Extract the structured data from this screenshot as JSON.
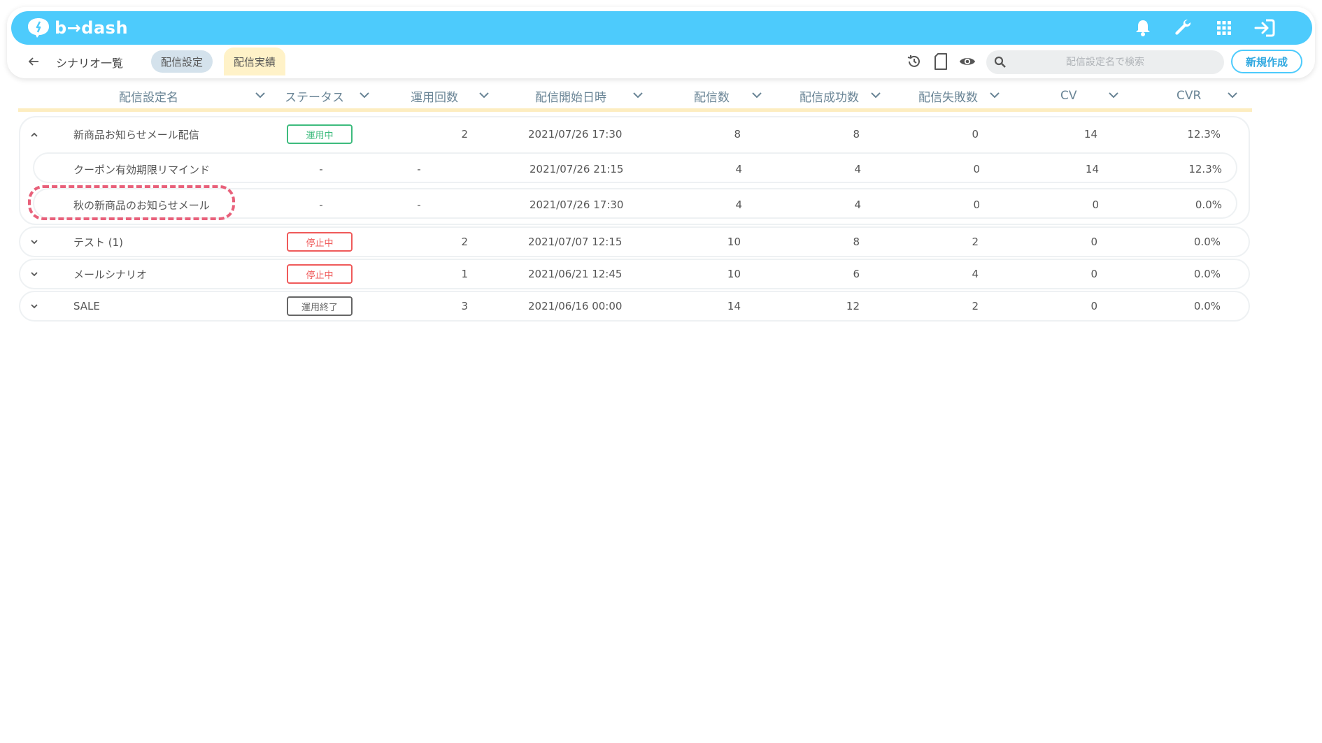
{
  "app": {
    "logo_text": "b→dash",
    "brand_color": "#4dcbfc"
  },
  "topbar": {
    "icons": [
      "bell-icon",
      "wrench-icon",
      "apps-grid-icon",
      "logout-icon"
    ]
  },
  "subbar": {
    "back_label": "シナリオ一覧",
    "tabs": [
      {
        "label": "配信設定",
        "selected": false
      },
      {
        "label": "配信実績",
        "selected": true
      }
    ],
    "tools": [
      "history-icon",
      "file-icon",
      "eye-icon"
    ],
    "search_placeholder": "配信設定名で検索",
    "new_button": "新規作成"
  },
  "table": {
    "columns": [
      "配信設定名",
      "ステータス",
      "運用回数",
      "配信開始日時",
      "配信数",
      "配信成功数",
      "配信失敗数",
      "CV",
      "CVR"
    ],
    "groups": [
      {
        "expanded": true,
        "name": "新商品お知らせメール配信",
        "status": "運用中",
        "status_kind": "active",
        "runs": "2",
        "start": "2021/07/26 17:30",
        "sent": "8",
        "success": "8",
        "failed": "0",
        "cv": "14",
        "cvr": "12.3%",
        "children": [
          {
            "name": "クーポン有効期限リマインド",
            "status": "-",
            "runs": "-",
            "start": "2021/07/26 21:15",
            "sent": "4",
            "success": "4",
            "failed": "0",
            "cv": "14",
            "cvr": "12.3%"
          },
          {
            "name": "秋の新商品のお知らせメール",
            "status": "-",
            "runs": "-",
            "start": "2021/07/26 17:30",
            "sent": "4",
            "success": "4",
            "failed": "0",
            "cv": "0",
            "cvr": "0.0%"
          }
        ]
      },
      {
        "expanded": false,
        "name": "テスト (1)",
        "status": "停止中",
        "status_kind": "stopped",
        "runs": "2",
        "start": "2021/07/07 12:15",
        "sent": "10",
        "success": "8",
        "failed": "2",
        "cv": "0",
        "cvr": "0.0%"
      },
      {
        "expanded": false,
        "name": "メールシナリオ",
        "status": "停止中",
        "status_kind": "stopped",
        "runs": "1",
        "start": "2021/06/21 12:45",
        "sent": "10",
        "success": "6",
        "failed": "4",
        "cv": "0",
        "cvr": "0.0%"
      },
      {
        "expanded": false,
        "name": "SALE",
        "status": "運用終了",
        "status_kind": "ended",
        "runs": "3",
        "start": "2021/06/16 00:00",
        "sent": "14",
        "success": "12",
        "failed": "2",
        "cv": "0",
        "cvr": "0.0%"
      }
    ]
  },
  "colors": {
    "active": "#3dbb7d",
    "stopped": "#ef5a5a",
    "ended": "#666666",
    "highlight": "#e8607a",
    "header_underline": "#fdedc0"
  }
}
